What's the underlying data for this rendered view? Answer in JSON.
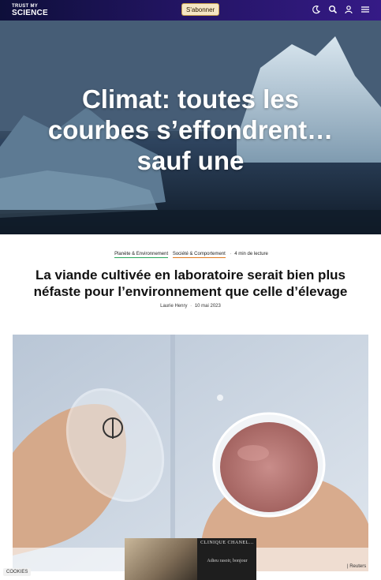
{
  "header": {
    "logo_line1": "TRUST MY",
    "logo_line2": "SCIENCE",
    "subscribe_label": "S'abonner",
    "icons": [
      "moon-icon",
      "search-icon",
      "user-icon",
      "menu-icon"
    ],
    "background": "#1b1650"
  },
  "hero": {
    "title": "Climat: toutes les courbes s’effondrent… sauf une"
  },
  "article": {
    "tags": [
      "Planète & Environnement",
      "Société & Comportement"
    ],
    "read_time": "4 min de lecture",
    "title": "La viande cultivée en laboratoire serait bien plus néfaste pour l’environnement que celle d’élevage",
    "author": "Laurie Henry",
    "date": "10 mai 2023",
    "image_credit": "| Reuters"
  },
  "cookies": {
    "label": "COOKIES"
  },
  "ad": {
    "brand": "CLINIQUE CHANEL...",
    "text": "Adieu rasoir, bonjour"
  },
  "colors": {
    "tag_green": "#2aa65b",
    "tag_orange": "#e07a1f",
    "subscribe_border": "#c9a14a"
  }
}
